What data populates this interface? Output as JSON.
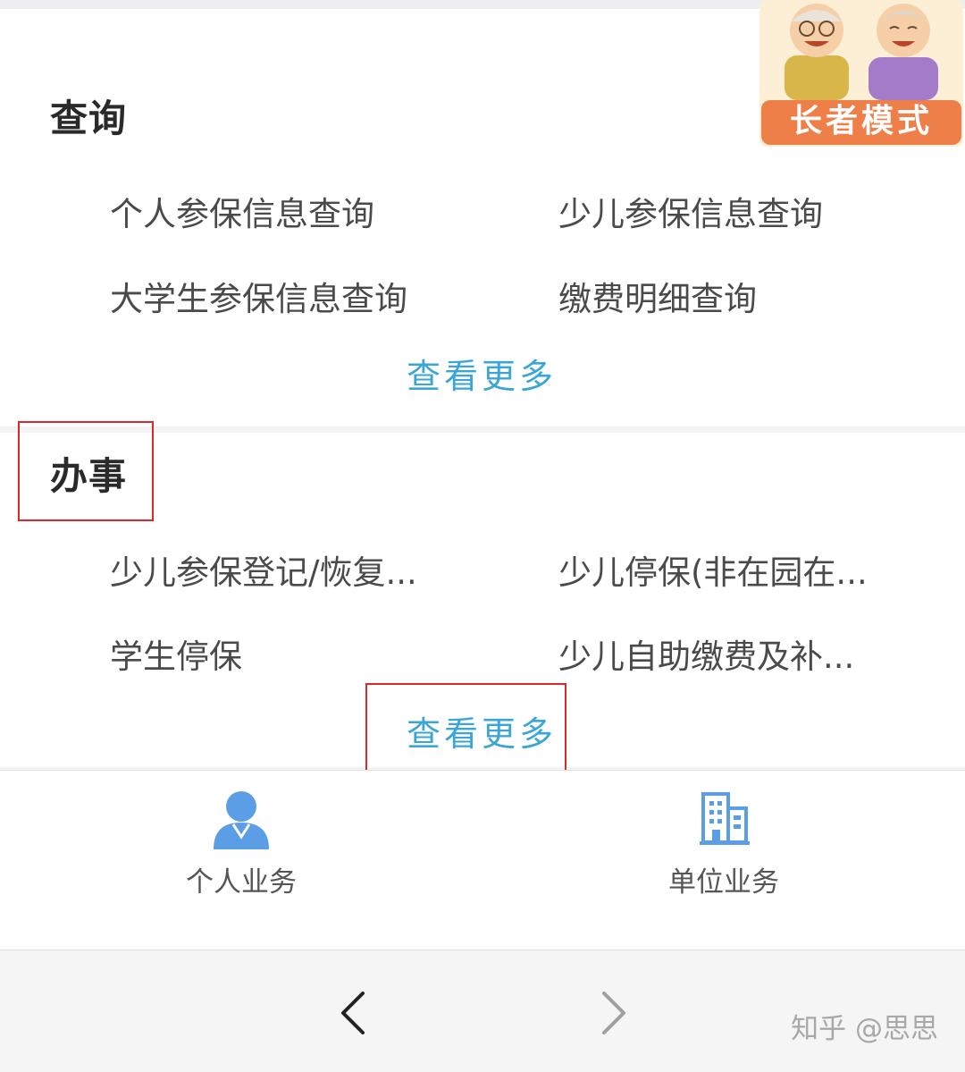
{
  "query_section": {
    "title": "查询",
    "items": [
      "个人参保信息查询",
      "少儿参保信息查询",
      "大学生参保信息查询",
      "缴费明细查询"
    ],
    "more_label": "查看更多"
  },
  "affairs_section": {
    "title": "办事",
    "items": [
      "少儿参保登记/恢复...",
      "少儿停保(非在园在...",
      "学生停保",
      "少儿自助缴费及补..."
    ],
    "more_label": "查看更多"
  },
  "tabbar": {
    "personal_label": "个人业务",
    "unit_label": "单位业务"
  },
  "elder_mode": {
    "label": "长者模式"
  },
  "watermark": "知乎 @思思",
  "colors": {
    "accent_blue": "#3aa5d6",
    "icon_blue": "#5b9ee6",
    "highlight_red": "#d82a2a",
    "badge_orange": "#ef7f48"
  }
}
